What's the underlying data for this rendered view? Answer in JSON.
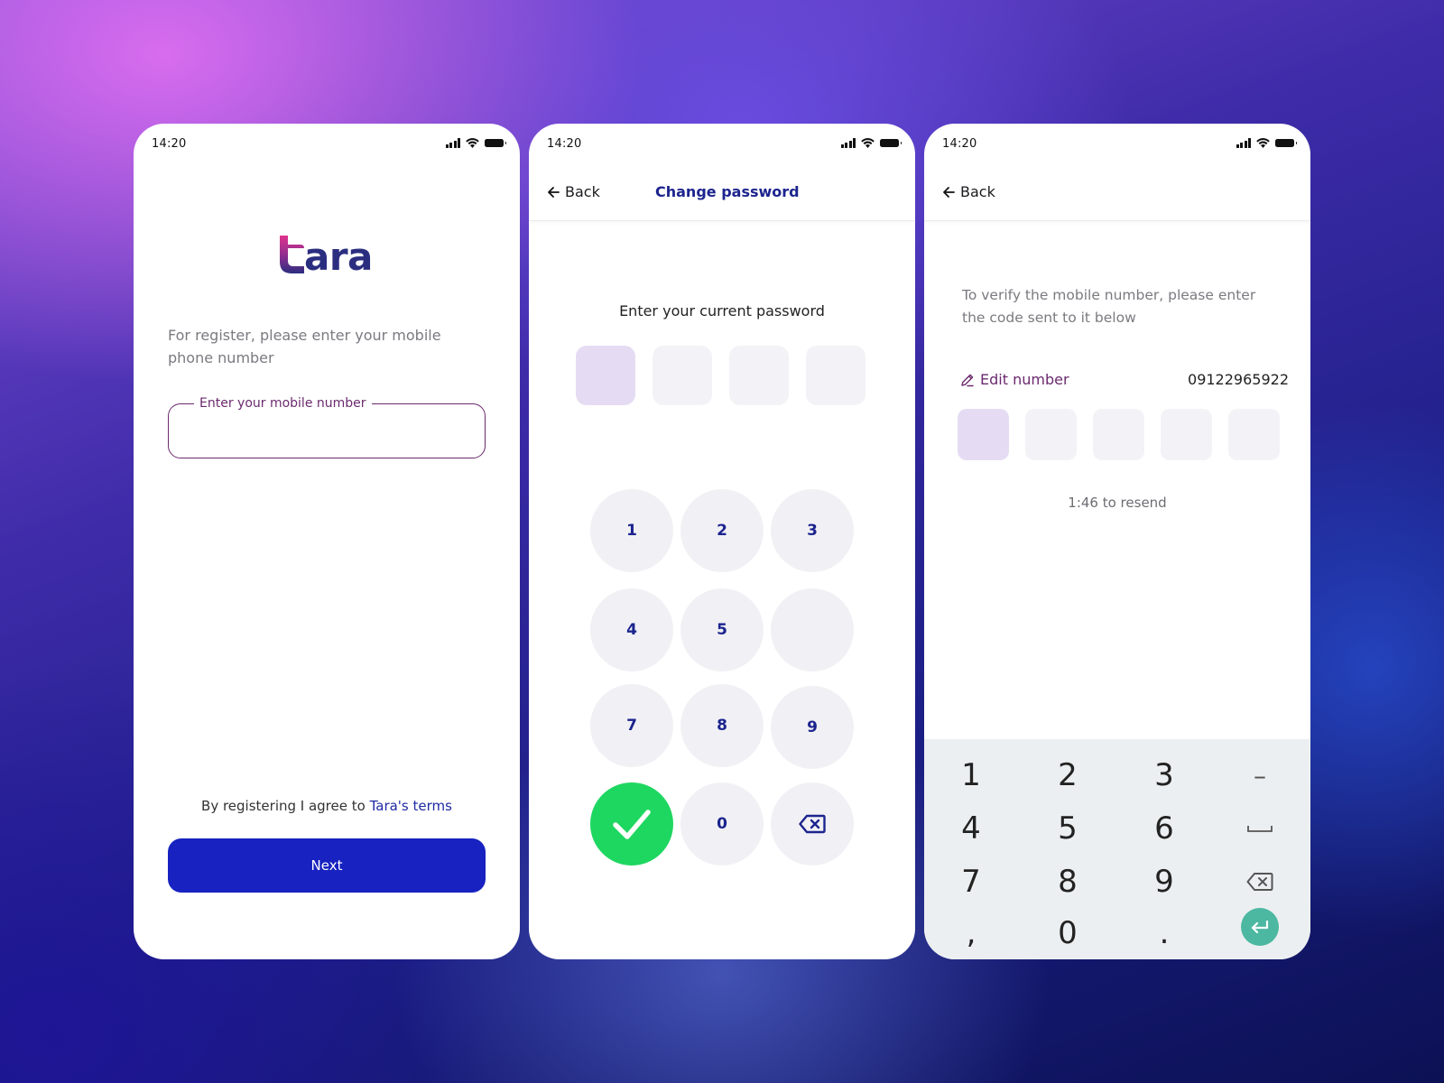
{
  "status_bar": {
    "time": "14:20"
  },
  "register_screen": {
    "logo_text": "ara",
    "intro": "For register, please enter your mobile phone number",
    "mobile_field_label": "Enter your mobile number",
    "mobile_field_value": "",
    "terms_prefix": "By registering I agree to ",
    "terms_link": "Tara's terms",
    "next_label": "Next"
  },
  "change_password_screen": {
    "back_label": "Back",
    "title": "Change password",
    "prompt": "Enter your current password",
    "pin_boxes": 4,
    "keypad": [
      {
        "label": "1"
      },
      {
        "label": "2"
      },
      {
        "label": "3"
      },
      {
        "label": "4"
      },
      {
        "label": "5"
      },
      {
        "label": ""
      },
      {
        "label": "7"
      },
      {
        "label": "8"
      },
      {
        "label": "9"
      },
      {
        "label": "check-icon"
      },
      {
        "label": "0"
      },
      {
        "label": "backspace-icon"
      }
    ]
  },
  "verify_screen": {
    "back_label": "Back",
    "instructions": "To verify the mobile number, please enter the code sent to it below",
    "edit_number_label": "Edit number",
    "phone_number": "09122965922",
    "code_boxes": 5,
    "resend_text": "1:46 to resend",
    "keyboard": {
      "row1": [
        "1",
        "2",
        "3",
        "–"
      ],
      "row2": [
        "4",
        "5",
        "6",
        "space-icon"
      ],
      "row3": [
        "7",
        "8",
        "9",
        "backspace-icon"
      ],
      "row4": [
        ",",
        "0",
        ".",
        "enter-icon"
      ]
    }
  },
  "colors": {
    "primary_button": "#1722c0",
    "title_navy": "#1c248e",
    "accent_purple": "#6b2a6e",
    "confirm_green": "#1ed760",
    "enter_teal": "#4cb8a2",
    "active_box": "#e5dcf3"
  }
}
